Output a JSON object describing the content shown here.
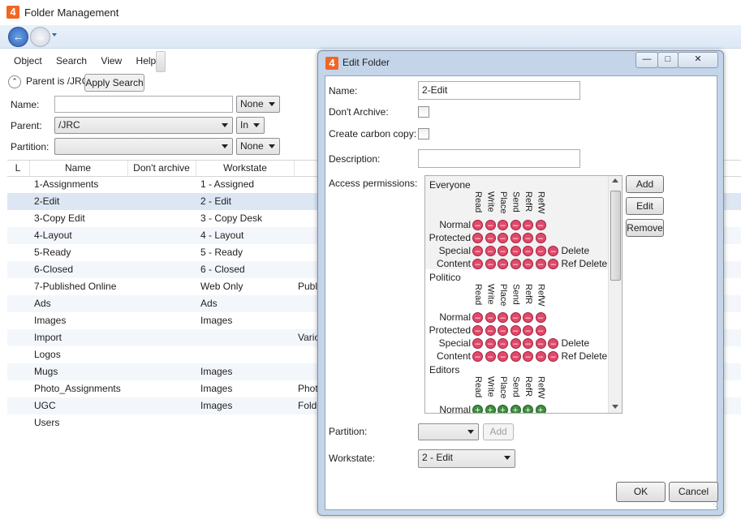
{
  "window": {
    "title": "Folder Management",
    "icon_text": "4"
  },
  "menu": [
    "Object",
    "Search",
    "View",
    "Help"
  ],
  "search": {
    "parent_text": "Parent is /JRC",
    "apply_label": "Apply Search",
    "name_label": "Name:",
    "name_value": "",
    "name_op": "None",
    "parent_label": "Parent:",
    "parent_value": "/JRC",
    "parent_op": "In",
    "partition_label": "Partition:",
    "partition_value": "",
    "partition_op": "None"
  },
  "grid": {
    "columns": [
      "L",
      "Name",
      "Don't archive",
      "Workstate"
    ],
    "rows": [
      {
        "name": "1-Assignments",
        "workstate": "1 - Assigned",
        "extra": ""
      },
      {
        "name": "2-Edit",
        "workstate": "2 - Edit",
        "extra": ""
      },
      {
        "name": "3-Copy Edit",
        "workstate": "3 - Copy Desk",
        "extra": ""
      },
      {
        "name": "4-Layout",
        "workstate": "4 - Layout",
        "extra": ""
      },
      {
        "name": "5-Ready",
        "workstate": "5 - Ready",
        "extra": ""
      },
      {
        "name": "6-Closed",
        "workstate": "6 - Closed",
        "extra": ""
      },
      {
        "name": "7-Published Online",
        "workstate": "Web Only",
        "extra": "Publi"
      },
      {
        "name": "Ads",
        "workstate": "Ads",
        "extra": ""
      },
      {
        "name": "Images",
        "workstate": "Images",
        "extra": ""
      },
      {
        "name": "Import",
        "workstate": "",
        "extra": "Vario"
      },
      {
        "name": "Logos",
        "workstate": "",
        "extra": ""
      },
      {
        "name": "Mugs",
        "workstate": "Images",
        "extra": ""
      },
      {
        "name": "Photo_Assignments",
        "workstate": "Images",
        "extra": "Phot"
      },
      {
        "name": "UGC",
        "workstate": "Images",
        "extra": "Folde"
      },
      {
        "name": "Users",
        "workstate": "",
        "extra": ""
      }
    ]
  },
  "dialog": {
    "title": "Edit Folder",
    "icon_text": "4",
    "name_label": "Name:",
    "name_value": "2-Edit",
    "dont_archive_label": "Don't Archive:",
    "carbon_label": "Create carbon copy:",
    "description_label": "Description:",
    "description_value": "",
    "access_label": "Access permissions:",
    "add_label": "Add",
    "edit_label": "Edit",
    "remove_label": "Remove",
    "partition_label": "Partition:",
    "partition_add_label": "Add",
    "workstate_label": "Workstate:",
    "workstate_value": "2 - Edit",
    "ok_label": "OK",
    "cancel_label": "Cancel",
    "permission_headers": [
      "Read",
      "Write",
      "Place",
      "Send",
      "RefR",
      "RefW"
    ],
    "groups": [
      {
        "name": "Everyone",
        "rows": [
          {
            "label": "Normal",
            "dots": 6,
            "extra": ""
          },
          {
            "label": "Protected",
            "dots": 6,
            "extra": ""
          },
          {
            "label": "Special",
            "dots": 7,
            "extra": "Delete"
          },
          {
            "label": "Content",
            "dots": 7,
            "extra": "Ref Delete"
          }
        ]
      },
      {
        "name": "Politico",
        "rows": [
          {
            "label": "Normal",
            "dots": 6,
            "extra": ""
          },
          {
            "label": "Protected",
            "dots": 6,
            "extra": ""
          },
          {
            "label": "Special",
            "dots": 7,
            "extra": "Delete"
          },
          {
            "label": "Content",
            "dots": 7,
            "extra": "Ref Delete"
          }
        ]
      },
      {
        "name": "Editors",
        "rows": [
          {
            "label": "Normal",
            "dots": 6,
            "extra": ""
          }
        ]
      }
    ]
  },
  "colors": {
    "deny": "#e04a6a",
    "allow": "#3e8b3e",
    "selection": "#dde6f3"
  }
}
